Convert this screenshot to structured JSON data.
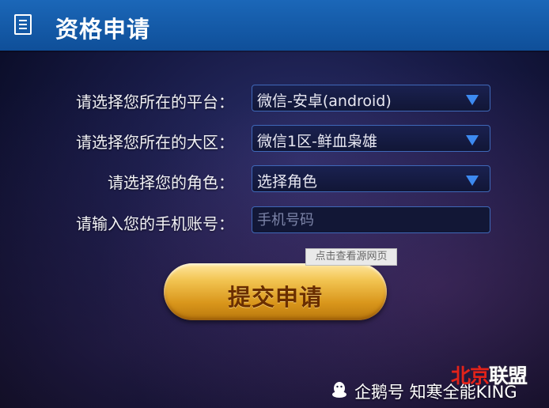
{
  "header": {
    "icon": "document-list-icon",
    "title": "资格申请"
  },
  "form": {
    "platform": {
      "label": "请选择您所在的平台：",
      "value": "微信-安卓(android)"
    },
    "region": {
      "label": "请选择您所在的大区：",
      "value": "微信1区-鲜血枭雄"
    },
    "role": {
      "label": "请选择您的角色：",
      "value": "选择角色"
    },
    "phone": {
      "label": "请输入您的手机账号：",
      "placeholder": "手机号码"
    }
  },
  "tooltip": "点击查看源网页",
  "submit_label": "提交申请",
  "watermark": {
    "icon": "penguin-icon",
    "text": "企鹅号 知寒全能KING"
  },
  "site_logo": {
    "part1": "北京",
    "part2": "联盟"
  },
  "colors": {
    "header": "#1560ad",
    "accent": "#3d8af0",
    "button": "#e0a62a"
  }
}
